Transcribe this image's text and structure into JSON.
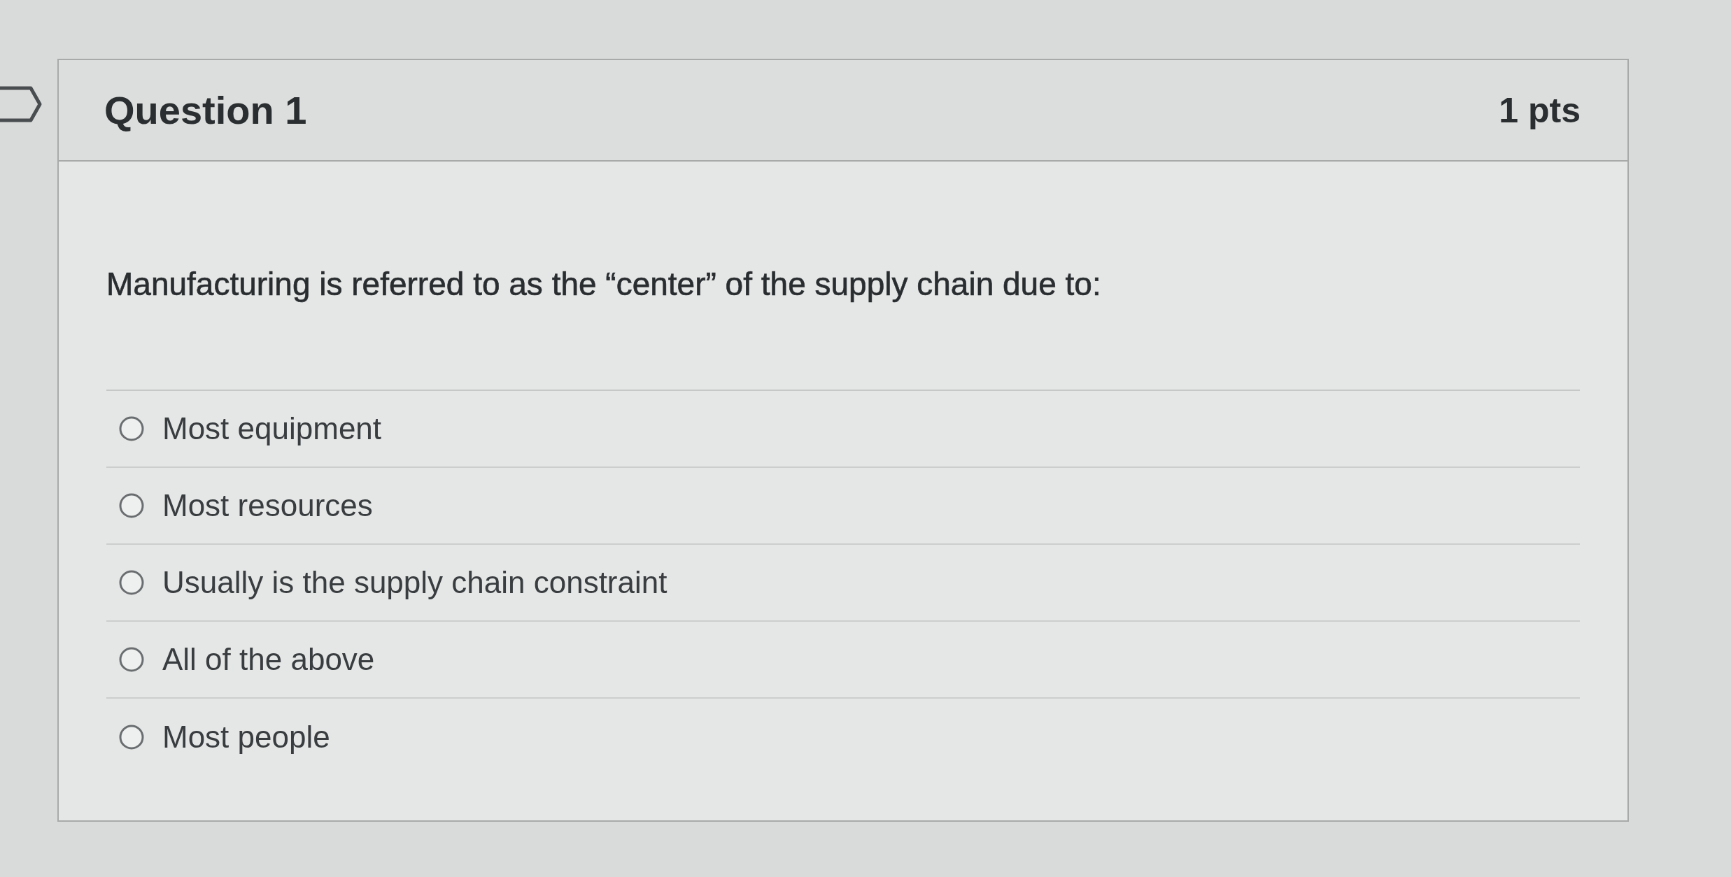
{
  "question": {
    "title": "Question 1",
    "points": "1 pts",
    "text": "Manufacturing is referred to as the “center” of the supply chain due to:",
    "answers": [
      {
        "label": "Most equipment",
        "selected": false
      },
      {
        "label": "Most resources",
        "selected": false
      },
      {
        "label": "Usually is the supply chain constraint",
        "selected": false
      },
      {
        "label": "All of the above",
        "selected": false
      },
      {
        "label": "Most people",
        "selected": false
      }
    ]
  }
}
